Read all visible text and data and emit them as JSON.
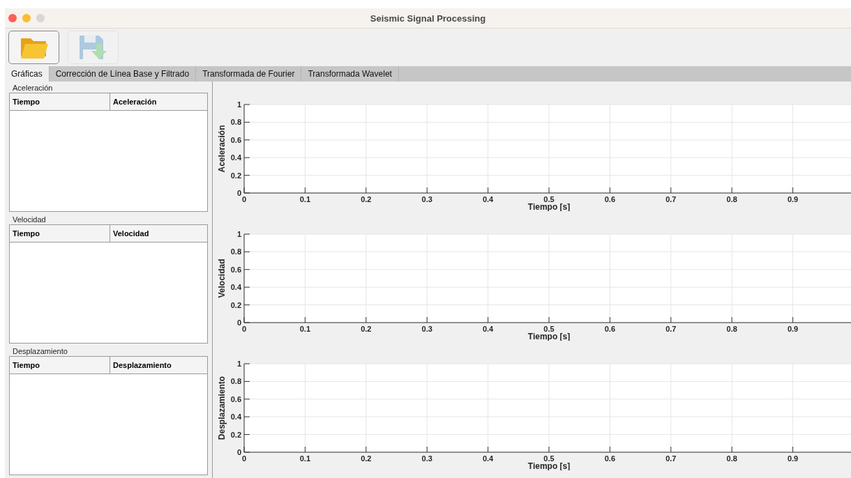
{
  "window": {
    "title": "Seismic Signal Processing"
  },
  "toolbar": [
    {
      "kind": "open",
      "disabled": false
    },
    {
      "kind": "save",
      "disabled": true
    }
  ],
  "tabs": [
    {
      "label": "Gráficas",
      "selected": true
    },
    {
      "label": "Corrección de Línea Base y Filtrado",
      "selected": false
    },
    {
      "label": "Transformada de Fourier",
      "selected": false
    },
    {
      "label": "Transformada Wavelet",
      "selected": false
    }
  ],
  "tables": [
    {
      "title": "Aceleración",
      "columns": [
        "Tiempo",
        "Aceleración"
      ]
    },
    {
      "title": "Velocidad",
      "columns": [
        "Tiempo",
        "Velocidad"
      ]
    },
    {
      "title": "Desplazamiento",
      "columns": [
        "Tiempo",
        "Desplazamiento"
      ]
    }
  ],
  "charts": [
    {
      "chart_data": {
        "type": "line",
        "xlabel": "Tiempo [s]",
        "ylabel": "Aceleración",
        "grid": true,
        "xlim": [
          0,
          1
        ],
        "ylim": [
          0,
          1
        ],
        "xticks": [
          0,
          0.1,
          0.2,
          0.3,
          0.4,
          0.5,
          0.6,
          0.7,
          0.8,
          0.9
        ],
        "yticks": [
          0,
          0.2,
          0.4,
          0.6,
          0.8,
          1
        ]
      }
    },
    {
      "chart_data": {
        "type": "line",
        "xlabel": "Tiempo [s]",
        "ylabel": "Velocidad",
        "grid": true,
        "xlim": [
          0,
          1
        ],
        "ylim": [
          0,
          1
        ],
        "xticks": [
          0,
          0.1,
          0.2,
          0.3,
          0.4,
          0.5,
          0.6,
          0.7,
          0.8,
          0.9
        ],
        "yticks": [
          0,
          0.2,
          0.4,
          0.6,
          0.8,
          1
        ]
      }
    },
    {
      "chart_data": {
        "type": "line",
        "xlabel": "Tiempo [s]",
        "ylabel": "Desplazamiento",
        "grid": true,
        "xlim": [
          0,
          1
        ],
        "ylim": [
          0,
          1
        ],
        "xticks": [
          0,
          0.1,
          0.2,
          0.3,
          0.4,
          0.5,
          0.6,
          0.7,
          0.8,
          0.9
        ],
        "yticks": [
          0,
          0.2,
          0.4,
          0.6,
          0.8,
          1
        ]
      }
    }
  ]
}
